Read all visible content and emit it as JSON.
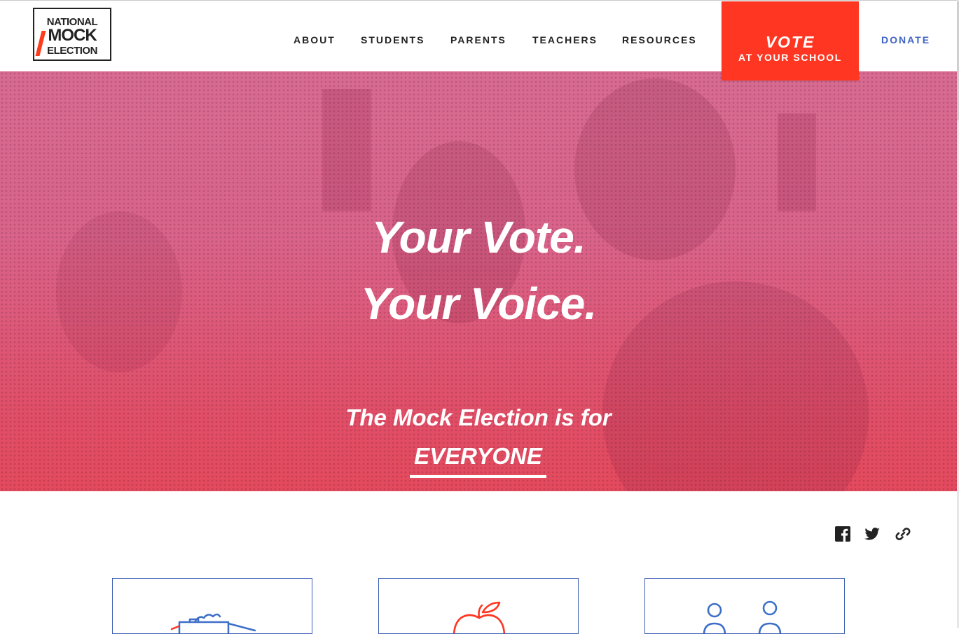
{
  "header": {
    "logo": {
      "line1": "NATIONAL",
      "line2": "MOCK",
      "line3": "ELECTION"
    },
    "nav": [
      {
        "label": "ABOUT"
      },
      {
        "label": "STUDENTS"
      },
      {
        "label": "PARENTS"
      },
      {
        "label": "TEACHERS"
      },
      {
        "label": "RESOURCES"
      }
    ],
    "vote_button": {
      "line1": "VOTE",
      "line2": "AT YOUR SCHOOL"
    },
    "donate_label": "DONATE"
  },
  "hero": {
    "headline_1": "Your Vote.",
    "headline_2": "Your Voice.",
    "subline": "The Mock Election is for",
    "highlight": "EVERYONE"
  },
  "share": {
    "icons": [
      "facebook-icon",
      "twitter-icon",
      "link-icon"
    ]
  },
  "cards": [
    {
      "icon": "classroom-bus-icon"
    },
    {
      "icon": "apple-icon"
    },
    {
      "icon": "people-icon"
    }
  ],
  "colors": {
    "accent_red": "#ff3621",
    "donate_blue": "#3f63c5",
    "card_border": "#3d5fb2",
    "hero_pink": "#d76b91",
    "hero_red": "#e44a5d"
  }
}
